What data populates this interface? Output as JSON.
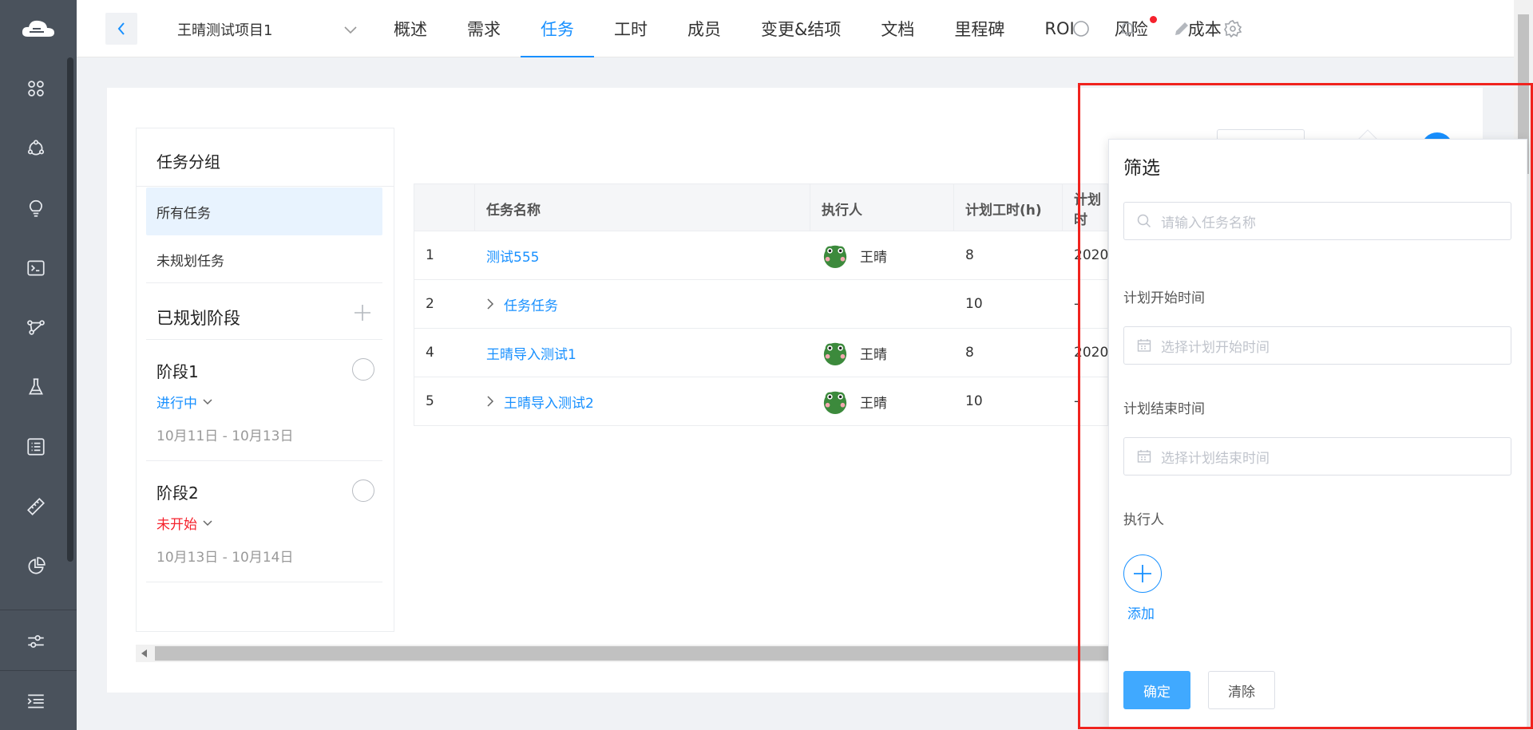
{
  "sidebar": {
    "icons": [
      "cloud-logo-icon",
      "apps-grid-icon",
      "network-icon",
      "bulb-icon",
      "terminal-icon",
      "flow-icon",
      "flask-icon",
      "list-icon",
      "ruler-icon",
      "pie-chart-icon",
      "sliders-icon",
      "collapse-menu-icon"
    ]
  },
  "header": {
    "project_name": "王晴测试项目1",
    "tabs": [
      {
        "label": "概述"
      },
      {
        "label": "需求"
      },
      {
        "label": "任务"
      },
      {
        "label": "工时"
      },
      {
        "label": "成员"
      },
      {
        "label": "变更&结项"
      },
      {
        "label": "文档"
      },
      {
        "label": "里程碑"
      },
      {
        "label": "ROI"
      },
      {
        "label": "风险"
      },
      {
        "label": "成本"
      }
    ],
    "active_tab": "任务"
  },
  "groups": {
    "title": "任务分组",
    "items": [
      {
        "label": "所有任务"
      },
      {
        "label": "未规划任务"
      }
    ],
    "planned_title": "已规划阶段",
    "stages": [
      {
        "name": "阶段1",
        "status": "进行中",
        "status_color": "#1890ff",
        "dates": "10月11日 - 10月13日"
      },
      {
        "name": "阶段2",
        "status": "未开始",
        "status_color": "#f5222d",
        "dates": "10月13日 - 10月14日"
      }
    ]
  },
  "table": {
    "headers": [
      "任务名称",
      "执行人",
      "计划工时(h)",
      "计划时"
    ],
    "rows": [
      {
        "index": "1",
        "name": "测试555",
        "assignee": "王晴",
        "hours": "8",
        "date": "2020"
      },
      {
        "index": "2",
        "name": "任务任务",
        "assignee": "",
        "hours": "10",
        "date": "-"
      },
      {
        "index": "4",
        "name": "王晴导入测试1",
        "assignee": "王晴",
        "hours": "8",
        "date": "2020"
      },
      {
        "index": "5",
        "name": "王晴导入测试2",
        "assignee": "王晴",
        "hours": "10",
        "date": "-"
      }
    ]
  },
  "filter": {
    "title": "筛选",
    "search_placeholder": "请输入任务名称",
    "start_label": "计划开始时间",
    "start_placeholder": "选择计划开始时间",
    "end_label": "计划结束时间",
    "end_placeholder": "选择计划结束时间",
    "assignee_label": "执行人",
    "add_label": "添加",
    "confirm_label": "确定",
    "clear_label": "清除"
  },
  "colors": {
    "accent": "#1890ff",
    "highlight": "#f0231e",
    "sidebar": "#4a525c"
  }
}
